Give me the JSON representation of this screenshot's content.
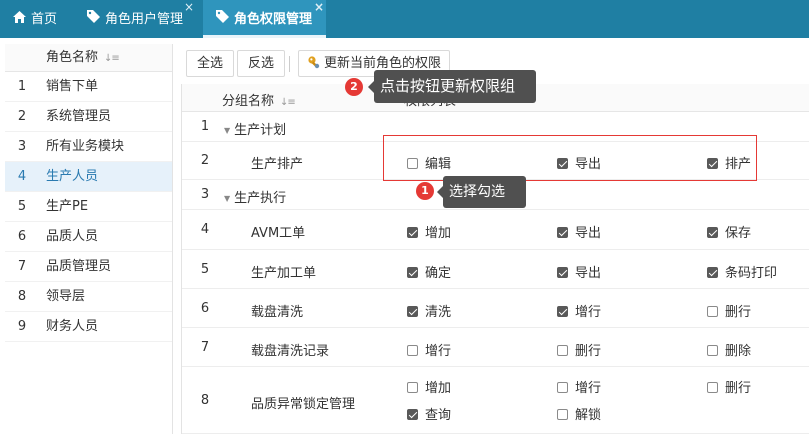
{
  "tabs": [
    {
      "label": "首页",
      "icon": "home-icon",
      "closable": false,
      "active": false
    },
    {
      "label": "角色用户管理",
      "icon": "tag-icon",
      "closable": true,
      "active": false
    },
    {
      "label": "角色权限管理",
      "icon": "tag-icon",
      "closable": true,
      "active": true
    }
  ],
  "close_glyph": "×",
  "roles": {
    "header": "角色名称",
    "items": [
      {
        "idx": "1",
        "name": "销售下单"
      },
      {
        "idx": "2",
        "name": "系统管理员"
      },
      {
        "idx": "3",
        "name": "所有业务模块"
      },
      {
        "idx": "4",
        "name": "生产人员",
        "selected": true
      },
      {
        "idx": "5",
        "name": "生产PE"
      },
      {
        "idx": "6",
        "name": "品质人员"
      },
      {
        "idx": "7",
        "name": "品质管理员"
      },
      {
        "idx": "8",
        "name": "领导层"
      },
      {
        "idx": "9",
        "name": "财务人员"
      }
    ]
  },
  "toolbar": {
    "select_all": "全选",
    "invert": "反选",
    "update": "更新当前角色的权限"
  },
  "grid": {
    "col_group": "分组名称",
    "col_perms": "权限列表",
    "rows": [
      {
        "idx": "1",
        "name": "生产计划",
        "group": true,
        "perms": []
      },
      {
        "idx": "2",
        "name": "生产排产",
        "group": false,
        "perms": [
          [
            {
              "label": "编辑",
              "checked": false
            },
            {
              "label": "导出",
              "checked": true
            },
            {
              "label": "排产",
              "checked": true
            }
          ]
        ]
      },
      {
        "idx": "3",
        "name": "生产执行",
        "group": true,
        "perms": []
      },
      {
        "idx": "4",
        "name": "AVM工单",
        "group": false,
        "perms": [
          [
            {
              "label": "增加",
              "checked": true
            },
            {
              "label": "导出",
              "checked": true
            },
            {
              "label": "保存",
              "checked": true
            }
          ]
        ]
      },
      {
        "idx": "5",
        "name": "生产加工单",
        "group": false,
        "perms": [
          [
            {
              "label": "确定",
              "checked": true
            },
            {
              "label": "导出",
              "checked": true
            },
            {
              "label": "条码打印",
              "checked": true
            }
          ]
        ]
      },
      {
        "idx": "6",
        "name": "载盘清洗",
        "group": false,
        "perms": [
          [
            {
              "label": "清洗",
              "checked": true
            },
            {
              "label": "增行",
              "checked": true
            },
            {
              "label": "删行",
              "checked": false
            }
          ]
        ]
      },
      {
        "idx": "7",
        "name": "载盘清洗记录",
        "group": false,
        "perms": [
          [
            {
              "label": "增行",
              "checked": false
            },
            {
              "label": "删行",
              "checked": false
            },
            {
              "label": "删除",
              "checked": false
            }
          ]
        ]
      },
      {
        "idx": "8",
        "name": "品质异常锁定管理",
        "group": false,
        "perms": [
          [
            {
              "label": "增加",
              "checked": false
            },
            {
              "label": "增行",
              "checked": false
            },
            {
              "label": "删行",
              "checked": false
            }
          ],
          [
            {
              "label": "查询",
              "checked": true
            },
            {
              "label": "解锁",
              "checked": false
            }
          ]
        ]
      }
    ]
  },
  "annotations": [
    {
      "number": "1",
      "text": "选择勾选"
    },
    {
      "number": "2",
      "text": "点击按钮更新权限组"
    }
  ],
  "colors": {
    "topbar": "#1f7fa3",
    "active_tab": "#2f95bd",
    "highlight": "#e53935",
    "tooltip": "#505050"
  }
}
